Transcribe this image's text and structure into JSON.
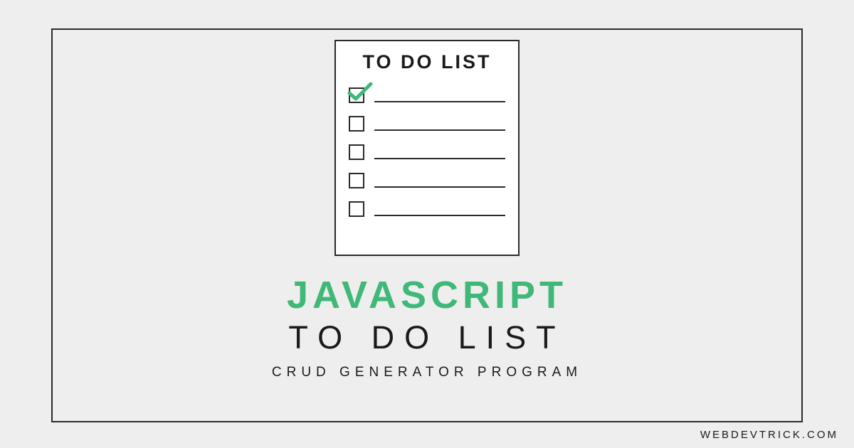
{
  "paper": {
    "title": "TO DO LIST",
    "items": [
      {
        "checked": true
      },
      {
        "checked": false
      },
      {
        "checked": false
      },
      {
        "checked": false
      },
      {
        "checked": false
      }
    ]
  },
  "heading": {
    "main": "JAVASCRIPT",
    "sub": "TO DO LIST",
    "desc": "CRUD GENERATOR PROGRAM"
  },
  "watermark": "WEBDEVTRICK.COM",
  "colors": {
    "accent": "#3fb878",
    "text": "#1a1a1a",
    "bg": "#eeeeee",
    "paper": "#ffffff"
  }
}
